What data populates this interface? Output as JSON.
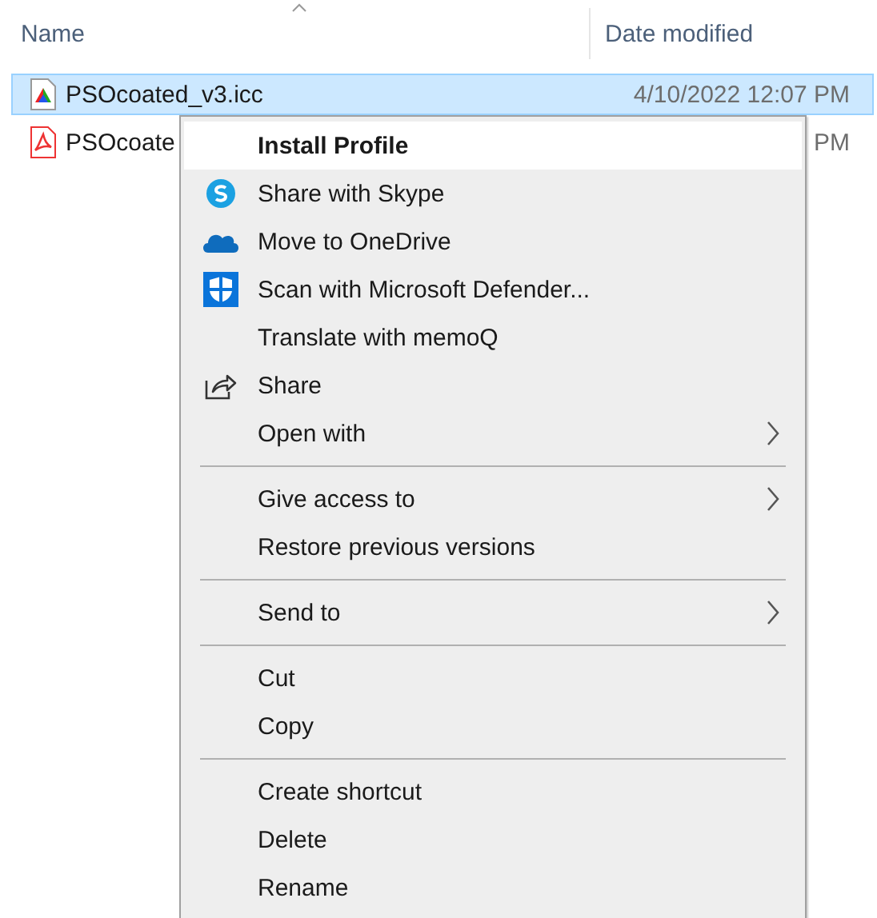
{
  "columns": [
    {
      "label": "Name"
    },
    {
      "label": "Date modified"
    }
  ],
  "files": [
    {
      "name": "PSOcoated_v3.icc",
      "date": "4/10/2022 12:07 PM",
      "kind": "profile",
      "selected": true
    },
    {
      "name": "PSOcoate",
      "date": "PM",
      "kind": "pdf",
      "selected": false
    }
  ],
  "menu": [
    {
      "kind": "default",
      "label": "Install Profile",
      "selected": true
    },
    {
      "kind": "skype",
      "label": "Share with Skype",
      "selected": false
    },
    {
      "kind": "cloud",
      "label": "Move to OneDrive",
      "selected": false
    },
    {
      "kind": "shield",
      "label": "Scan with Microsoft Defender...",
      "selected": false
    },
    {
      "kind": "plain",
      "label": "Translate with memoQ",
      "selected": false
    },
    {
      "kind": "share",
      "label": "Share",
      "selected": false
    },
    {
      "kind": "submenu",
      "label": "Open with",
      "selected": false
    },
    {
      "kind": "separator"
    },
    {
      "kind": "submenu",
      "label": "Give access to",
      "selected": false
    },
    {
      "kind": "plain",
      "label": "Restore previous versions",
      "selected": false
    },
    {
      "kind": "separator"
    },
    {
      "kind": "submenu",
      "label": "Send to",
      "selected": false
    },
    {
      "kind": "separator"
    },
    {
      "kind": "plain",
      "label": "Cut",
      "selected": false
    },
    {
      "kind": "plain",
      "label": "Copy",
      "selected": false
    },
    {
      "kind": "separator"
    },
    {
      "kind": "plain",
      "label": "Create shortcut",
      "selected": false
    },
    {
      "kind": "plain",
      "label": "Delete",
      "selected": false
    },
    {
      "kind": "plain",
      "label": "Rename",
      "selected": false
    }
  ]
}
